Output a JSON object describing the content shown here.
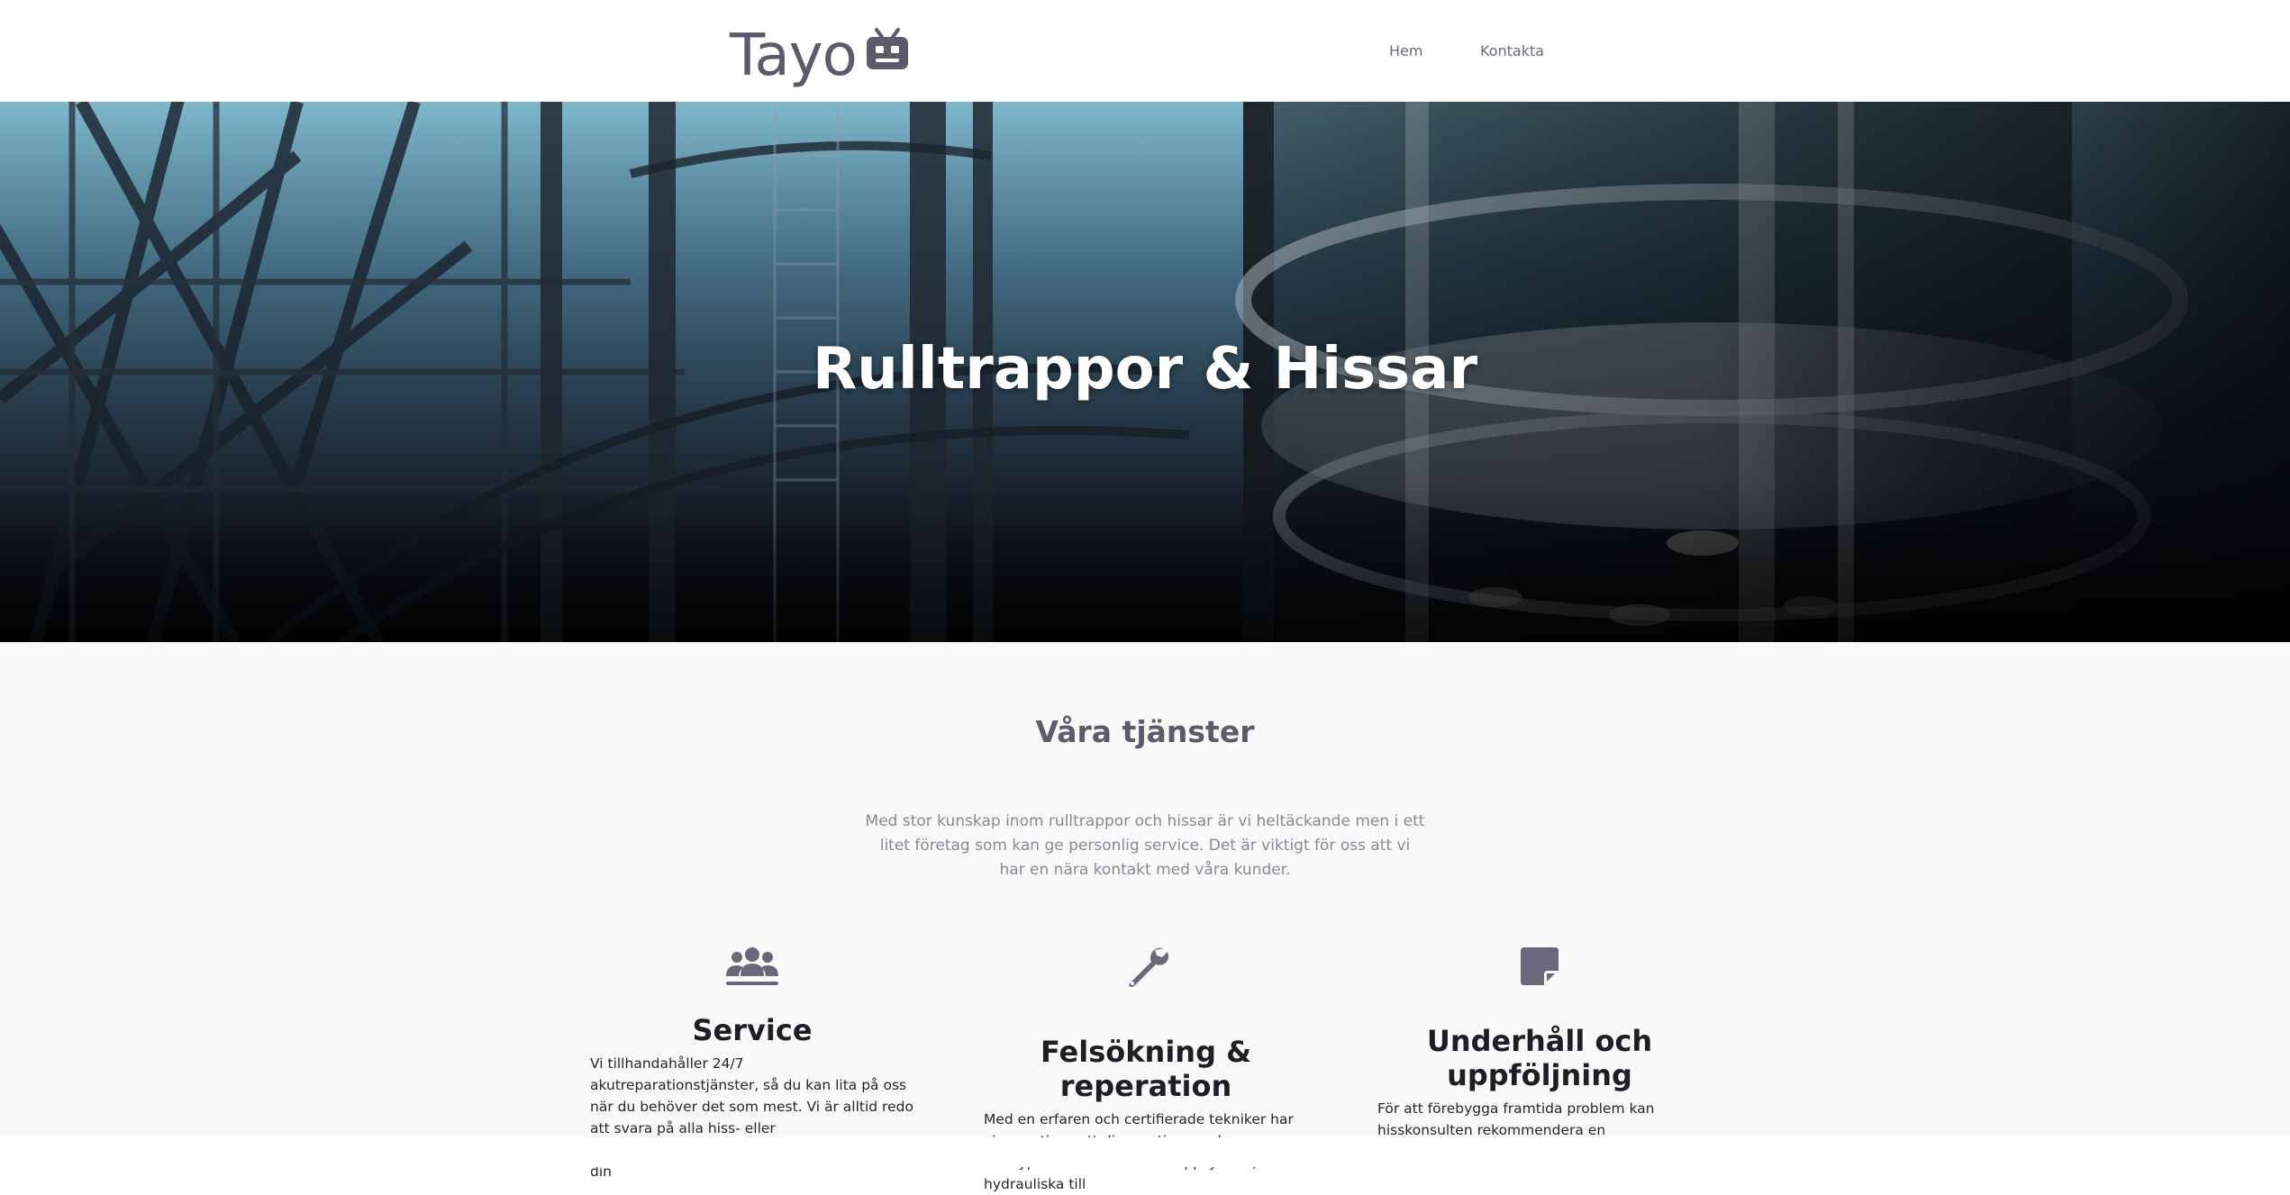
{
  "header": {
    "logo_text": "Tayo",
    "logo_icon": "robot-tv-icon",
    "nav": [
      {
        "label": "Hem"
      },
      {
        "label": "Kontakta"
      }
    ]
  },
  "hero": {
    "title": "Rulltrappor & Hissar",
    "image": "escalator-elevator-photo"
  },
  "services": {
    "title": "Våra tjänster",
    "intro": "Med stor kunskap inom rulltrappor och hissar är vi heltäckande men i ett litet företag som kan ge personlig service. Det är viktigt för oss att vi har en nära kontakt med våra kunder.",
    "cards": [
      {
        "icon": "users-icon",
        "title": "Service",
        "text": "Vi tillhandahåller 24/7 akutreparationstjänster, så du kan lita på oss när du behöver det som mest. Vi är alltid redo att svara på alla hiss- eller rulltrappsnödsituationer och säkerställa att din"
      },
      {
        "icon": "wrench-icon",
        "title": "Felsökning & reperation",
        "text": "Med en erfaren och certifierade tekniker har vi expertisen att diagnostisera och reparera alla typer av hiss- och rulltrappsystem, från hydrauliska till"
      },
      {
        "icon": "sticky-note-icon",
        "title": "Underhåll och uppföljning",
        "text": "För att förebygga framtida problem kan hisskonsulten rekommendera en underhållsplan"
      }
    ]
  },
  "colors": {
    "logo": "#5c5a6b",
    "icon": "#6a687a",
    "section_title": "#5c5a6b",
    "intro_text": "#8a8894",
    "services_bg": "#f9f9f9"
  }
}
